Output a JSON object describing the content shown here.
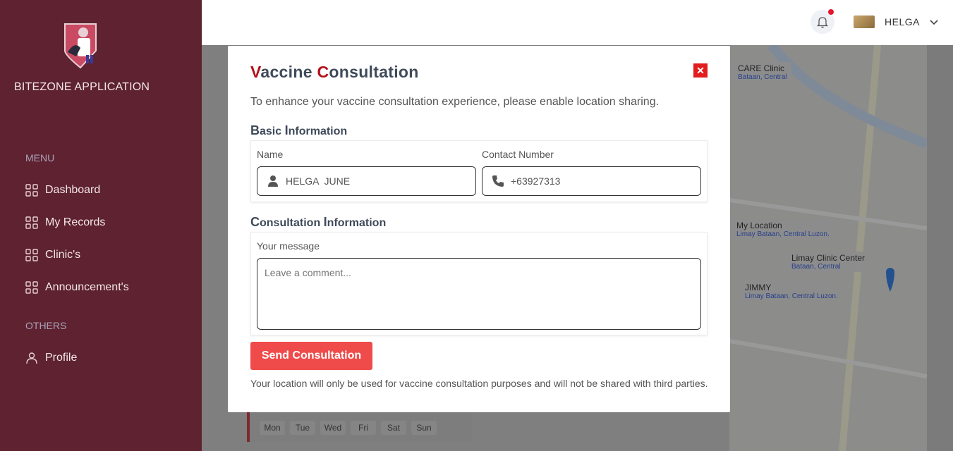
{
  "sidebar": {
    "app_title": "BITEZONE APPLICATION",
    "menu_label": "MENU",
    "items": [
      {
        "label": "Dashboard"
      },
      {
        "label": "My Records"
      },
      {
        "label": "Clinic's"
      },
      {
        "label": "Announcement's"
      }
    ],
    "others_label": "OTHERS",
    "profile_label": "Profile"
  },
  "topbar": {
    "user_name": "HELGA"
  },
  "background": {
    "map_labels": [
      {
        "title": "CARE Clinic",
        "subtitle": "Bataan, Central"
      },
      {
        "title": "My Location",
        "subtitle": "Limay Bataan, Central Luzon."
      },
      {
        "title": "Limay Clinic Center",
        "subtitle": "Bataan, Central"
      },
      {
        "title": "JIMMY",
        "subtitle": "Limay Bataan, Central Luzon."
      }
    ],
    "weekdays": [
      "Mon",
      "Tue",
      "Wed",
      "Fri",
      "Sat",
      "Sun"
    ]
  },
  "modal": {
    "title_first_letter": "V",
    "title_word1_rest": "accine ",
    "title_second_letter": "C",
    "title_word2_rest": "onsultation",
    "description": "To enhance your vaccine consultation experience, please enable location sharing.",
    "basic_section": {
      "cap": "B",
      "rest": "asic ",
      "cap2": "I",
      "rest2": "nformation"
    },
    "name_label": "Name",
    "name_value": "HELGA  JUNE",
    "contact_label": "Contact Number",
    "contact_value": "+63927313",
    "consult_section": {
      "cap": "C",
      "rest": "onsultation ",
      "cap2": "I",
      "rest2": "nformation"
    },
    "message_label": "Your message",
    "message_placeholder": "Leave a comment...",
    "send_label": "Send Consultation",
    "footnote": "Your location will only be used for vaccine consultation purposes and will not be shared with third parties."
  },
  "colors": {
    "sidebar_bg": "#5e2230",
    "accent_red": "#b4121b",
    "button_red": "#ef4b4b"
  }
}
